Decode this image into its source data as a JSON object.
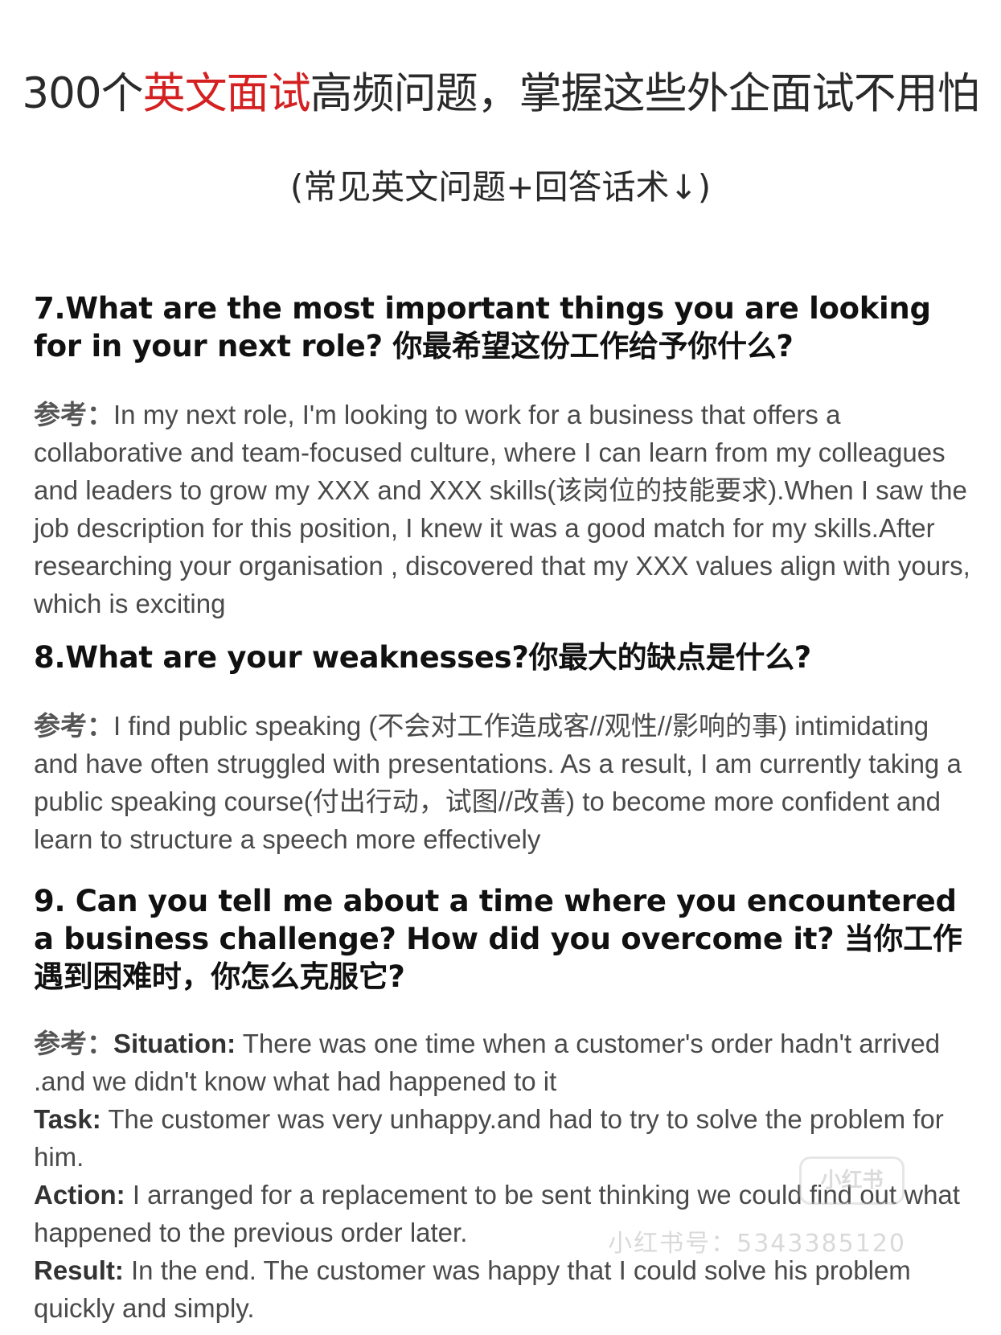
{
  "header": {
    "title_pre": "300个",
    "title_highlight": "英文面试",
    "title_post": "高频问题，掌握这些外企面试不用怕",
    "subtitle": "(常见英文问题+回答话术↓)"
  },
  "colors": {
    "highlight": "#d42020",
    "question_text": "#111111",
    "answer_text": "#4a4a4a"
  },
  "reference_label": "参考：",
  "questions": [
    {
      "question": "7.What are the most important things you are looking for in your next role? 你最希望这份工作给予你什么?",
      "answer": "In my next role, I'm looking to work for a business that offers a collaborative and team-focused culture, where I can learn from my colleagues and leaders to grow my XXX and XXX skills(该岗位的技能要求).When I saw the job description for this position, I knew it was a good match for my skills.After researching your organisation , discovered that my XXX values align with yours, which is exciting"
    },
    {
      "question": "8.What are your weaknesses?你最大的缺点是什么?",
      "answer": "I find public speaking (不会对工作造成客//观性//影响的事) intimidating and have often struggled with presentations. As a result, I am currently taking a public speaking course(付出行动，试图//改善) to become more confident and learn to structure a speech more effectively"
    },
    {
      "question": "9. Can you tell me about a time where you encountered a business challenge? How did you overcome it? 当你工作遇到困难时，你怎么克服它?",
      "star": [
        {
          "label": "Situation:",
          "text": " There was one time when a customer's order hadn't arrived .and we didn't know what had happened to it"
        },
        {
          "label": "Task:",
          "text": " The customer was very unhappy.and had to try to solve the problem for him."
        },
        {
          "label": "Action:",
          "text": " I arranged for a replacement to be sent thinking we could find out what happened to the previous order later."
        },
        {
          "label": "Result:",
          "text": " In the end. The customer was happy that I could solve his problem quickly and simply."
        }
      ]
    }
  ],
  "watermark": {
    "logo": "小红书",
    "id_text": "小红书号：5343385120"
  }
}
